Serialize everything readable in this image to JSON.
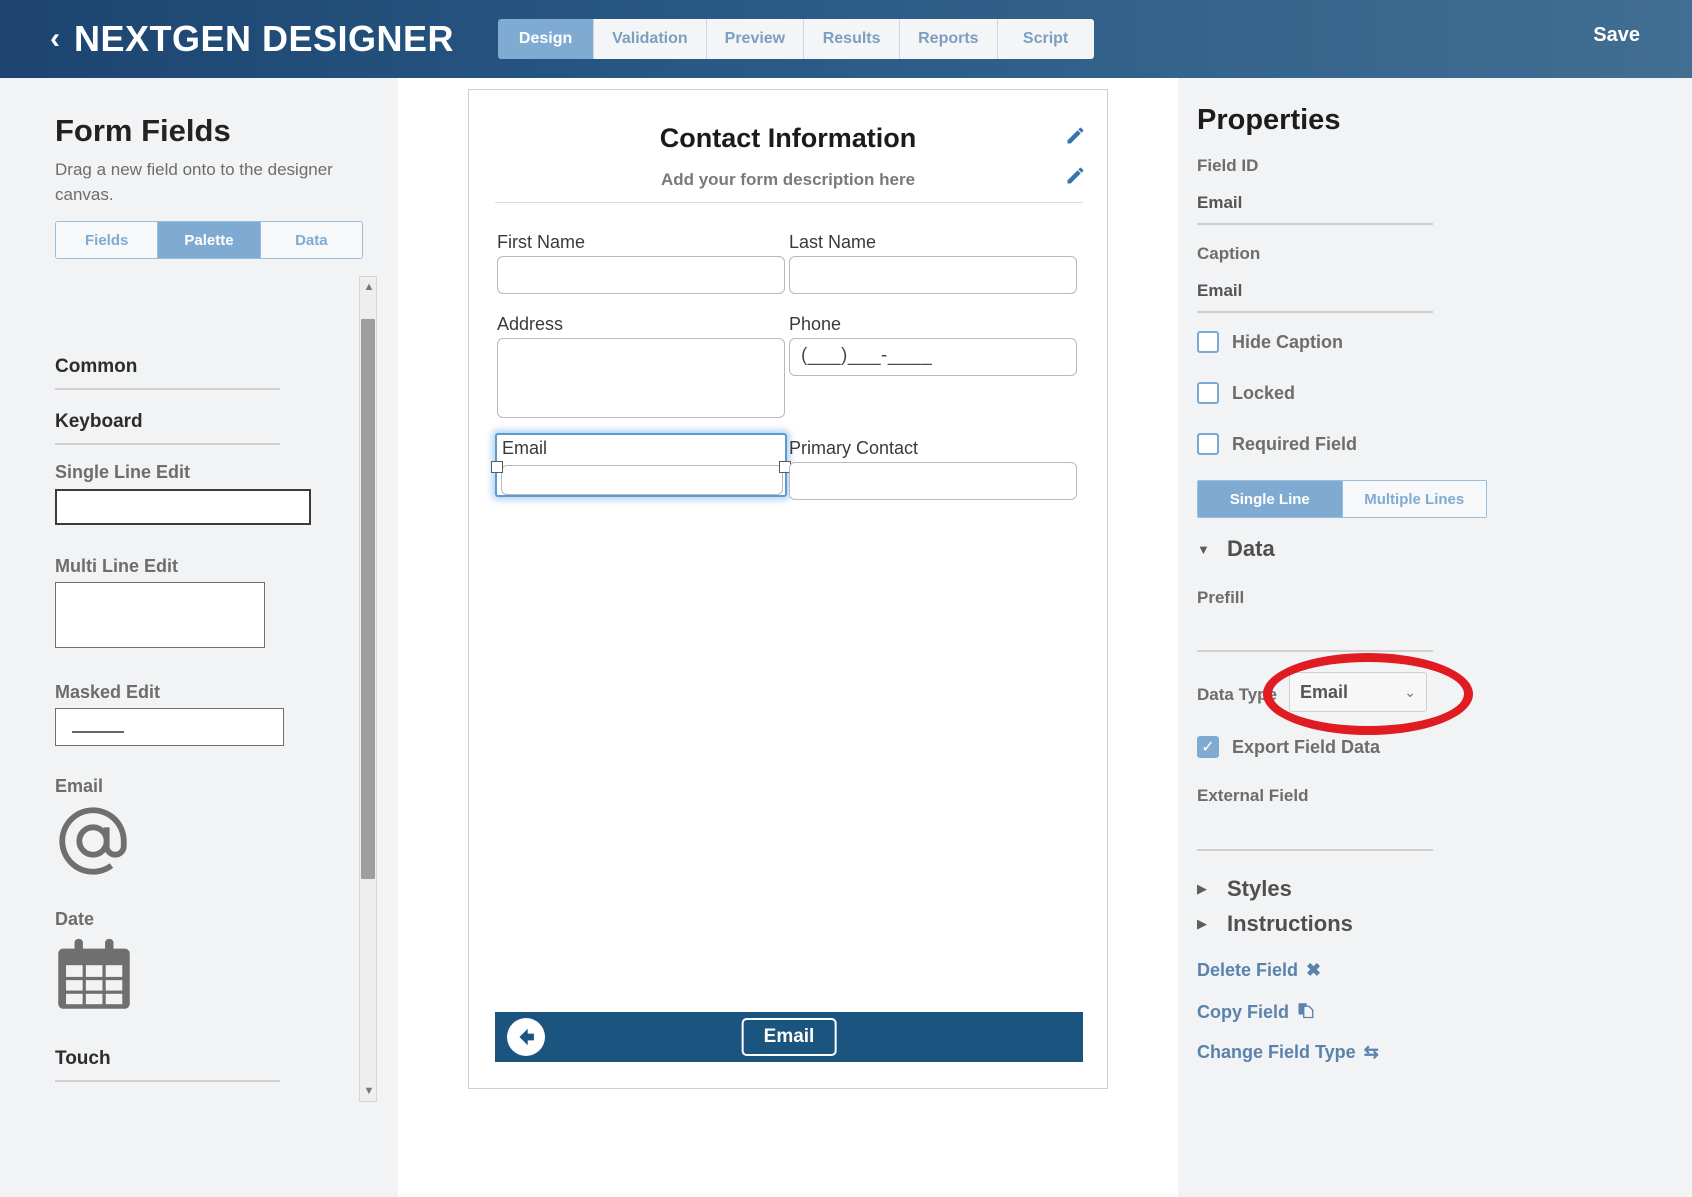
{
  "header": {
    "back_icon": "chevron-left-icon",
    "brand": "NEXTGEN DESIGNER",
    "tabs": [
      {
        "label": "Design",
        "active": true
      },
      {
        "label": "Validation",
        "active": false
      },
      {
        "label": "Preview",
        "active": false
      },
      {
        "label": "Results",
        "active": false
      },
      {
        "label": "Reports",
        "active": false
      },
      {
        "label": "Script",
        "active": false
      }
    ],
    "save_label": "Save"
  },
  "sidebar": {
    "title": "Form Fields",
    "subtitle": "Drag a new field onto to the designer canvas.",
    "tabs": [
      {
        "label": "Fields",
        "active": false
      },
      {
        "label": "Palette",
        "active": true
      },
      {
        "label": "Data",
        "active": false
      }
    ],
    "groups": [
      {
        "label": "Common"
      },
      {
        "label": "Keyboard"
      },
      {
        "label": "Touch"
      }
    ],
    "items": [
      {
        "label": "Single Line Edit",
        "icon": "single-line-edit-preview"
      },
      {
        "label": "Multi Line Edit",
        "icon": "multi-line-edit-preview"
      },
      {
        "label": "Masked Edit",
        "icon": "masked-edit-preview"
      },
      {
        "label": "Email",
        "icon": "at-sign-icon"
      },
      {
        "label": "Date",
        "icon": "calendar-icon"
      }
    ]
  },
  "canvas": {
    "form_title": "Contact Information",
    "form_description": "Add your form description here",
    "edit_title_icon": "pencil-icon",
    "edit_description_icon": "pencil-icon",
    "fields": [
      {
        "label": "First Name",
        "value": ""
      },
      {
        "label": "Last Name",
        "value": ""
      },
      {
        "label": "Address",
        "value": ""
      },
      {
        "label": "Phone",
        "value": "(___)___-____"
      },
      {
        "label": "Email",
        "value": "",
        "selected": true
      },
      {
        "label": "Primary Contact",
        "value": ""
      }
    ],
    "footer": {
      "back_icon": "arrow-left-circle-icon",
      "chip_label": "Email"
    }
  },
  "properties": {
    "title": "Properties",
    "field_id_label": "Field ID",
    "field_id_value": "Email",
    "caption_label": "Caption",
    "caption_value": "Email",
    "checkboxes": [
      {
        "label": "Hide Caption",
        "checked": false
      },
      {
        "label": "Locked",
        "checked": false
      },
      {
        "label": "Required Field",
        "checked": false
      }
    ],
    "line_mode": [
      {
        "label": "Single Line",
        "active": true
      },
      {
        "label": "Multiple Lines",
        "active": false
      }
    ],
    "data_section": {
      "title": "Data",
      "expanded": true,
      "prefill_label": "Prefill",
      "prefill_value": "",
      "data_type_label": "Data Type",
      "data_type_value": "Email",
      "export_field_data": {
        "label": "Export Field Data",
        "checked": true
      },
      "external_field_label": "External Field",
      "external_field_value": ""
    },
    "sections": [
      {
        "label": "Styles",
        "expanded": false
      },
      {
        "label": "Instructions",
        "expanded": false
      }
    ],
    "actions": [
      {
        "label": "Delete Field",
        "icon": "close-x-icon"
      },
      {
        "label": "Copy Field",
        "icon": "copy-icon"
      },
      {
        "label": "Change Field Type",
        "icon": "swap-arrows-icon"
      }
    ]
  },
  "annotation": {
    "shape": "ellipse-highlight",
    "color": "#e01b22",
    "targets": "data-type-select"
  }
}
